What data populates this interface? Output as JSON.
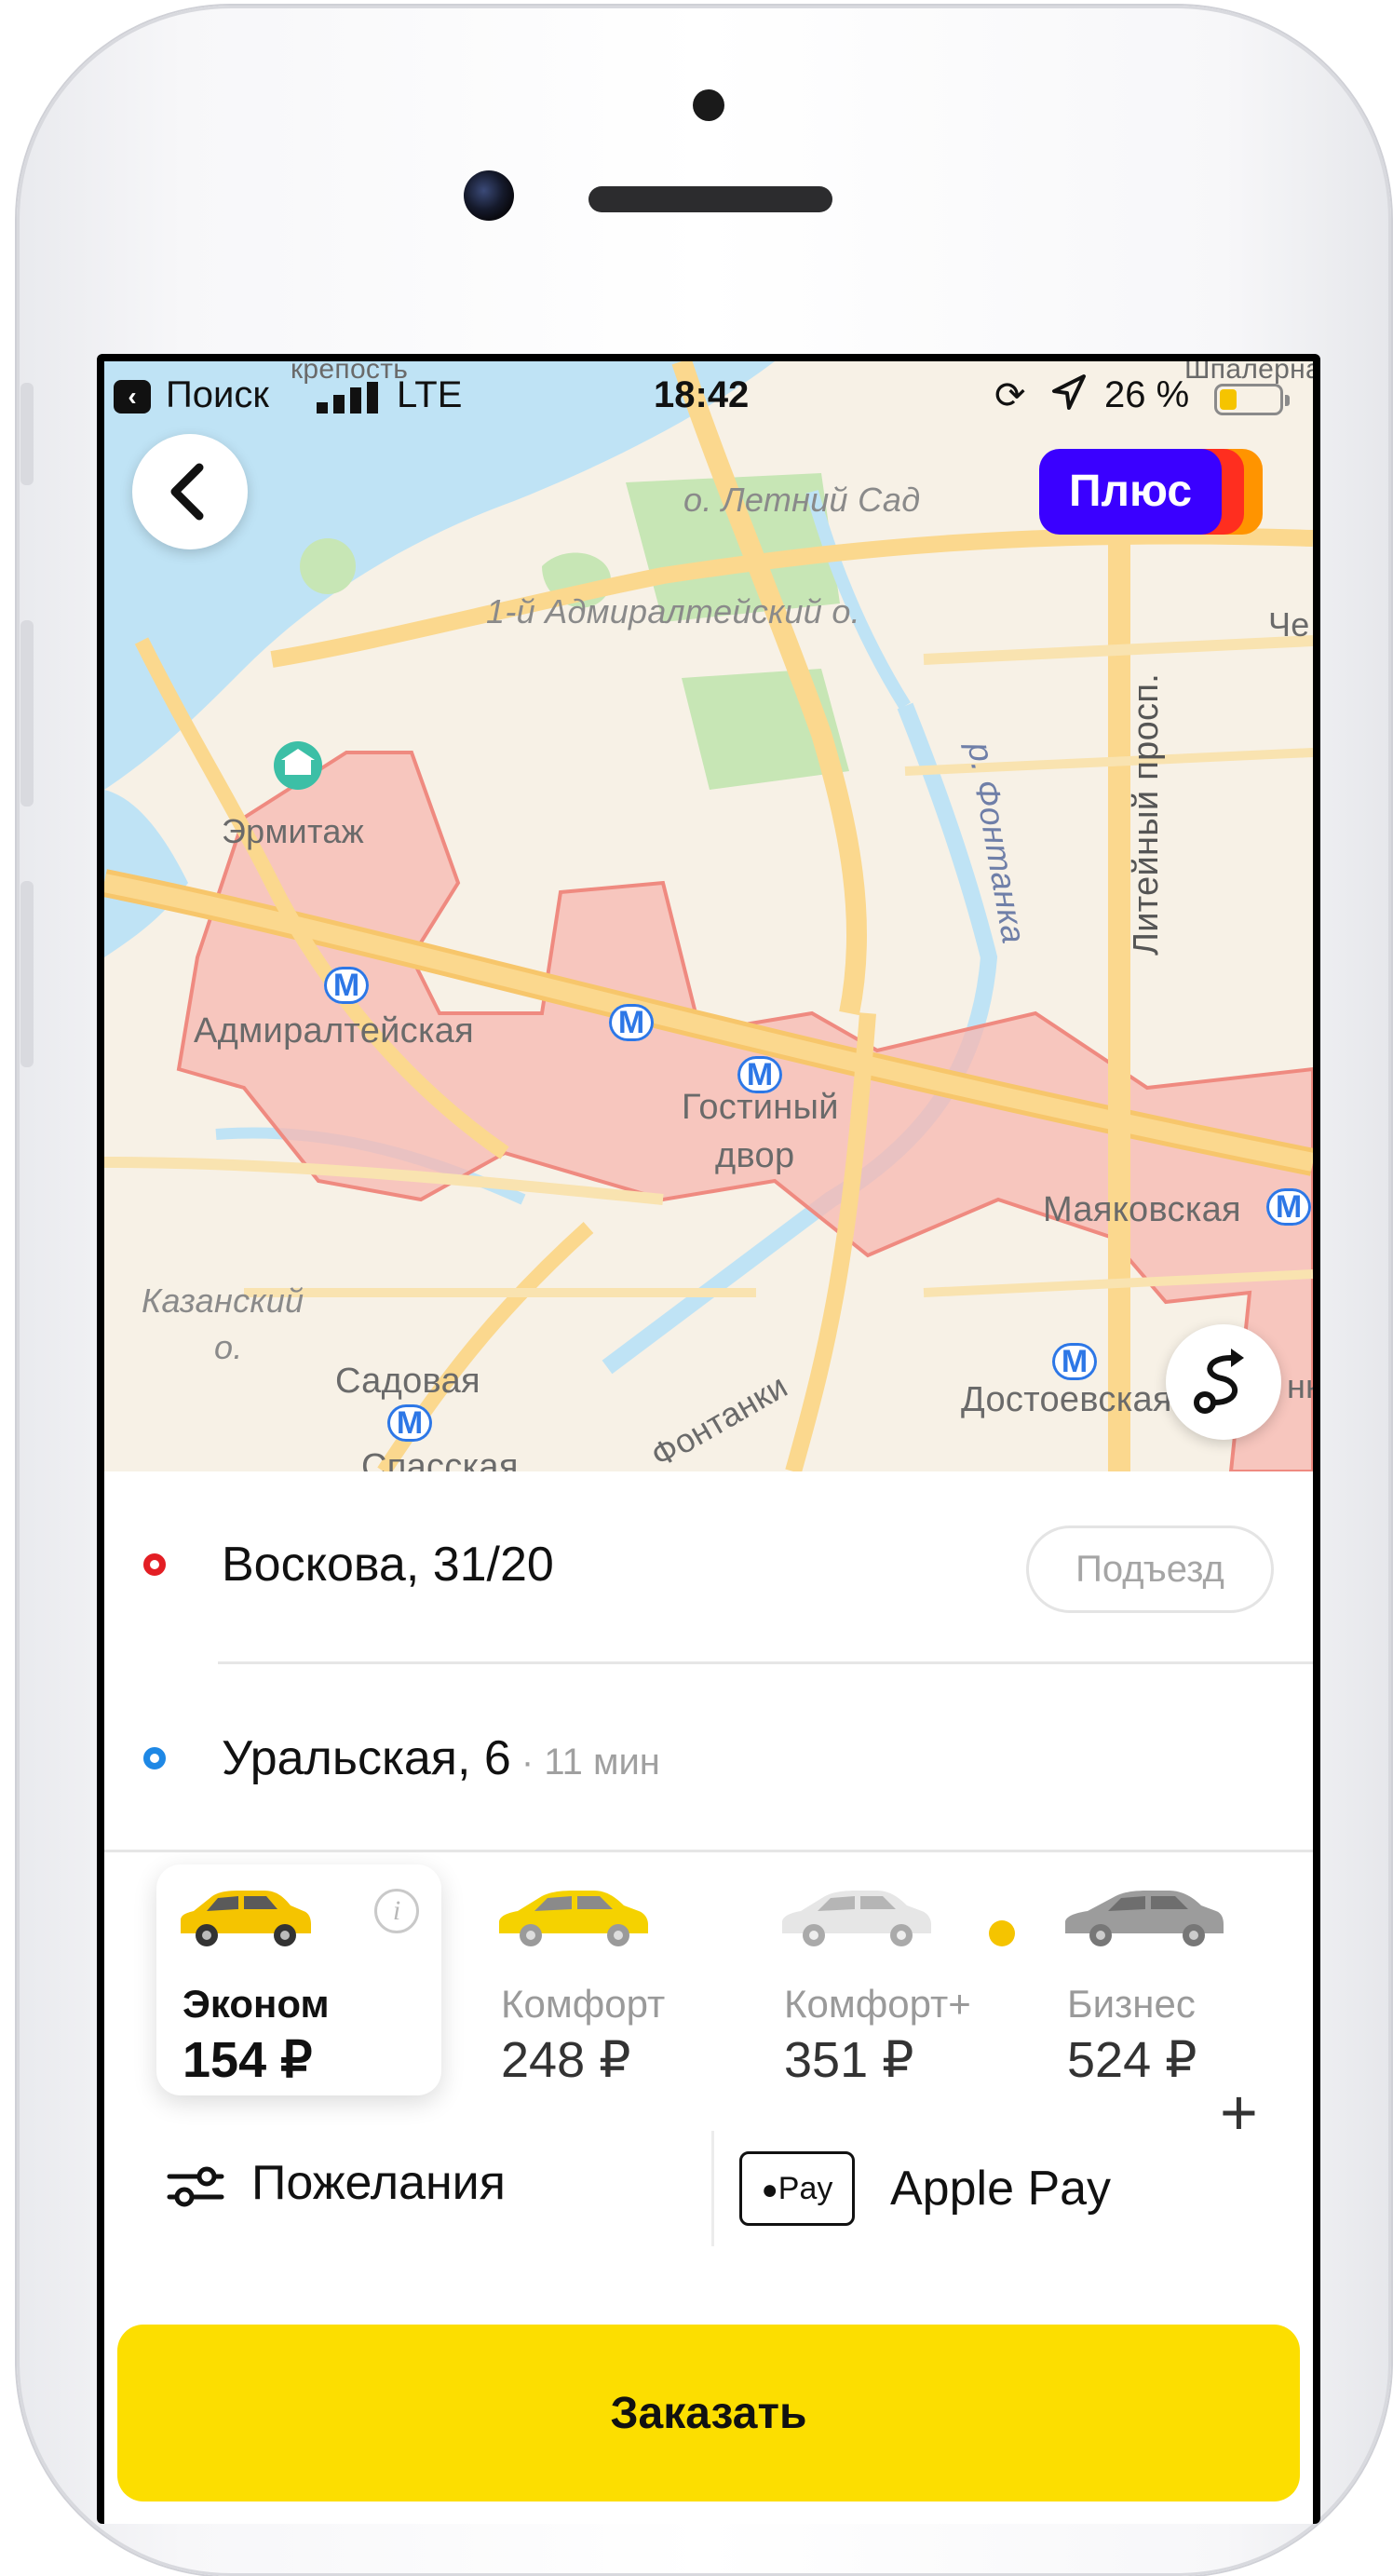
{
  "status_bar": {
    "back_app": "Поиск",
    "network": "LTE",
    "time": "18:42",
    "battery_text": "26 %",
    "battery_level": 0.26
  },
  "map": {
    "labels": {
      "fortress": "крепость",
      "letniy_sad": "о. Летний Сад",
      "admiralteysky": "1-й Адмиралтейский о.",
      "ermitazh": "Эрмитаж",
      "admiralteyskaya": "Адмиралтейская",
      "gostiny": "Гостиный",
      "dvor": "двор",
      "mayakovskaya": "Маяковская",
      "kazansky": "Казанский",
      "o": "о.",
      "sadovaya": "Садовая",
      "spasskaya": "Спасская",
      "fontanki": "Фонтанки",
      "dostoevskaya": "Достоевская",
      "liteyny": "Литейный просп.",
      "fontanka_river": "р. Фонтанка",
      "che": "Че",
      "shpalernaya": "Шпалерна",
      "nk": "нк"
    },
    "metro_symbol": "М",
    "plus_badge": "Плюс",
    "back_icon": "chevron-left-icon",
    "route_icon": "route-icon"
  },
  "addresses": {
    "from": {
      "text": "Воскова, 31/20",
      "entrance_chip": "Подъезд",
      "color": "#e31e24"
    },
    "to": {
      "text": "Уральская, 6",
      "eta": " · 11 мин",
      "add": "+",
      "color": "#1e88e5"
    }
  },
  "tariffs": [
    {
      "name": "Эконом",
      "price": "154 ₽",
      "active": true,
      "car_color": "#f5c400",
      "info": "i"
    },
    {
      "name": "Комфорт",
      "price": "248 ₽",
      "active": false,
      "car_color": "#f5d200"
    },
    {
      "name": "Комфорт+",
      "price": "351 ₽",
      "active": false,
      "car_color": "#e6e6e6"
    },
    {
      "name": "Бизнес",
      "price": "524 ₽",
      "active": false,
      "car_color": "#9c9c9c"
    }
  ],
  "options": {
    "wishes": "Пожелания",
    "wishes_icon": "sliders-icon",
    "payment_badge": "Pay",
    "payment": "Apple Pay"
  },
  "order_button": "Заказать",
  "colors": {
    "accent_yellow": "#fcde00",
    "zone_fill": "#f7b7b0",
    "water": "#bfe3f5"
  }
}
